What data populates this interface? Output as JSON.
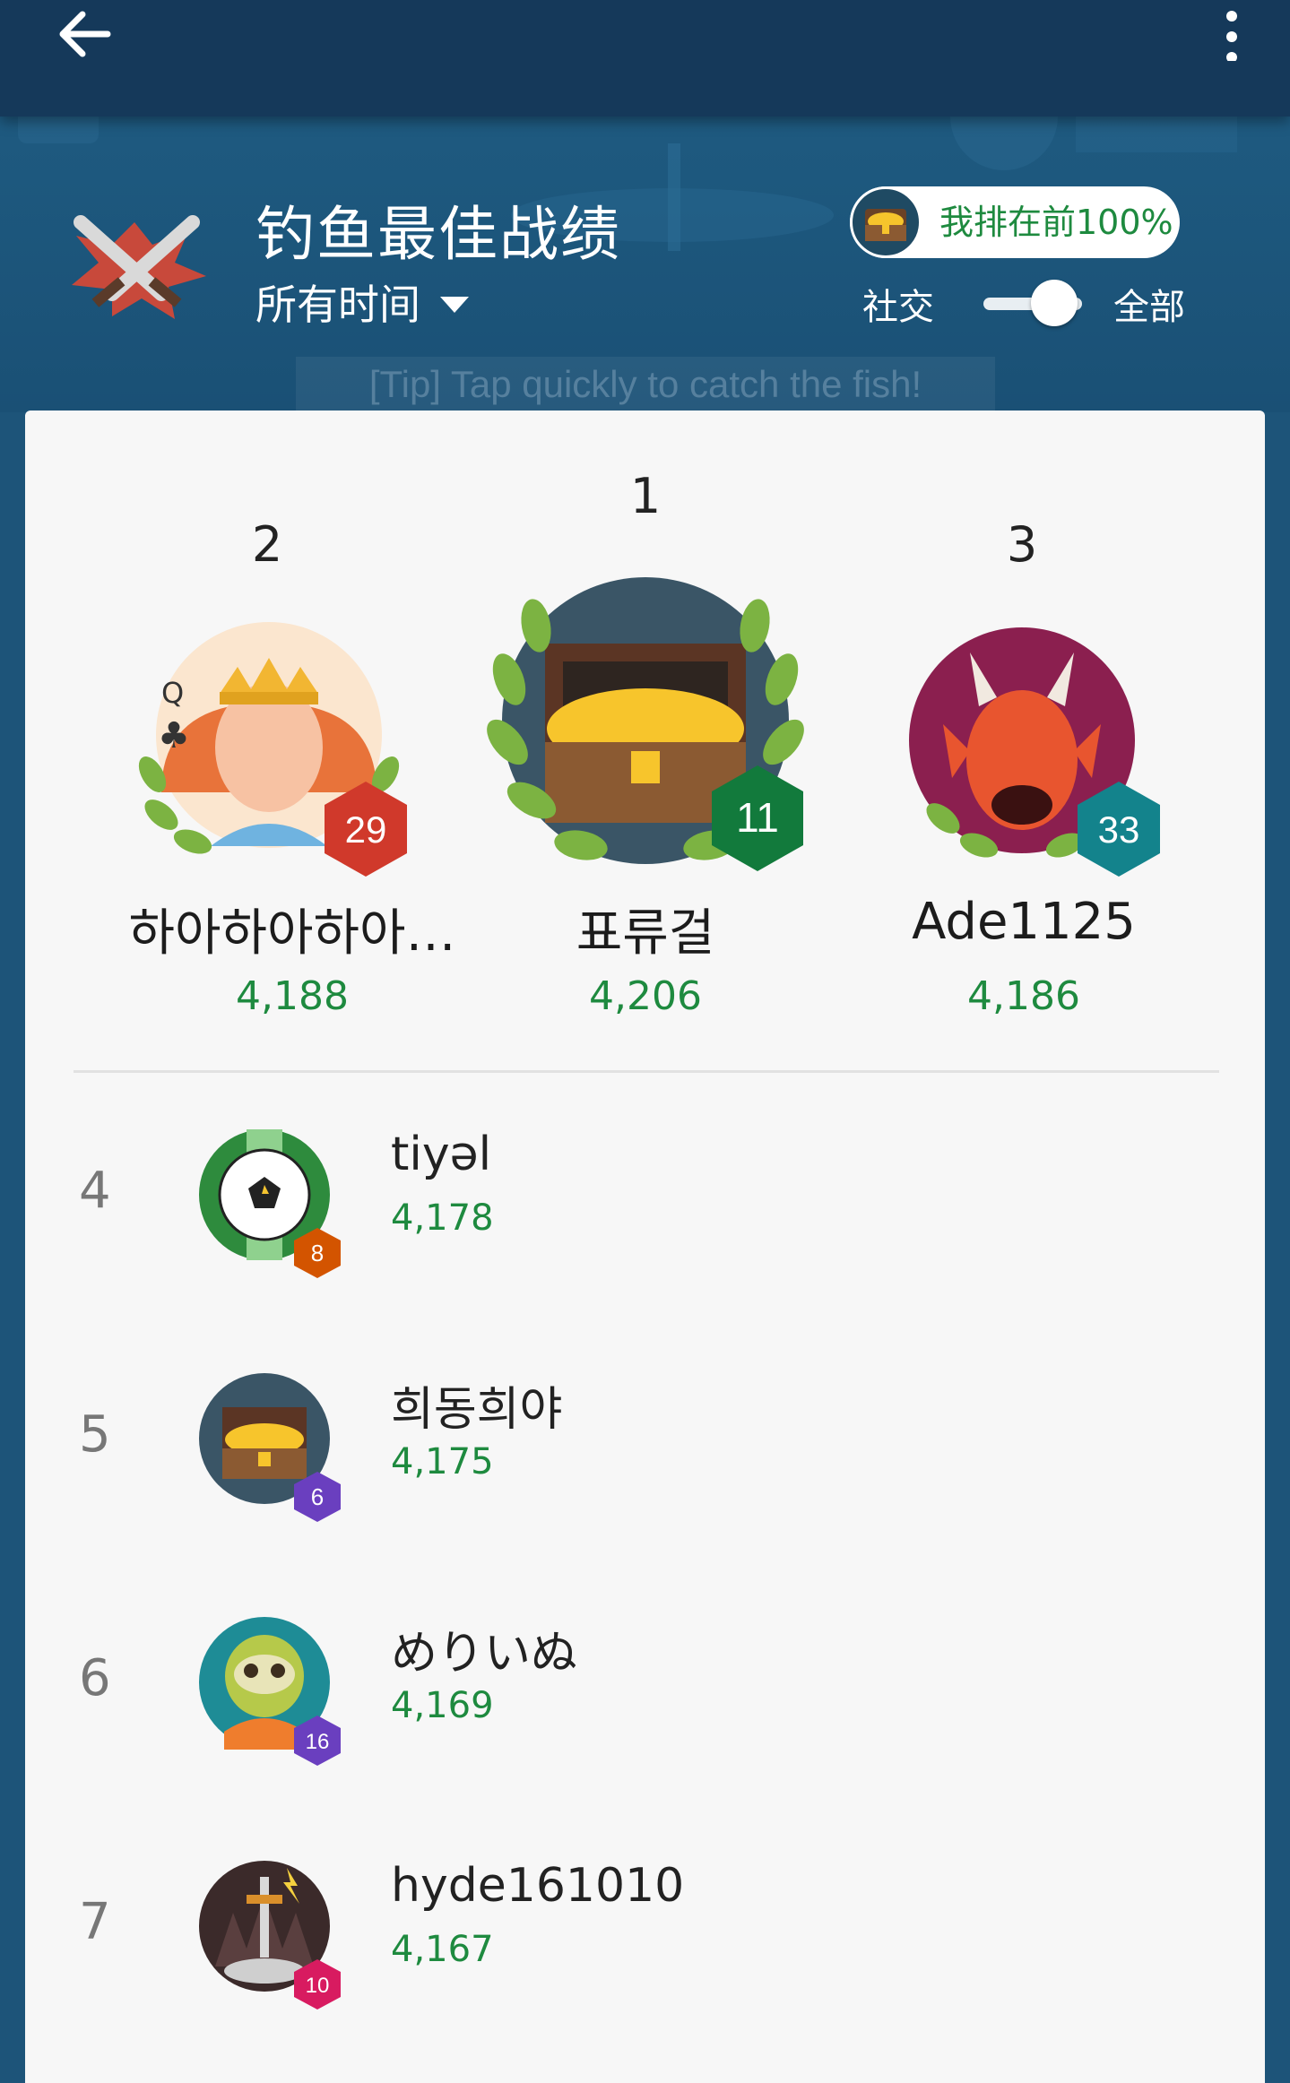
{
  "appbar": {
    "back_icon": "arrow-left-icon",
    "more_icon": "more-vertical-icon"
  },
  "background_tip": "[Tip] Tap quickly to catch the fish!",
  "header": {
    "title": "钓鱼最佳战绩",
    "time_filter": "所有时间",
    "rank_badge": "我排在前100%",
    "toggle_left": "社交",
    "toggle_right": "全部",
    "toggle_on": true
  },
  "podium": [
    {
      "rank": "2",
      "name": "하아하아하아…",
      "score": "4,188",
      "level": "29",
      "level_color": "#d0392b",
      "avatar": "queen-avatar"
    },
    {
      "rank": "1",
      "name": "표류걸",
      "score": "4,206",
      "level": "11",
      "level_color": "#127a3c",
      "avatar": "treasure-chest-avatar"
    },
    {
      "rank": "3",
      "name": "Ade1125",
      "score": "4,186",
      "level": "33",
      "level_color": "#13838c",
      "avatar": "dragon-avatar"
    }
  ],
  "list": [
    {
      "rank": "4",
      "name": "tiyəl",
      "score": "4,178",
      "level": "8",
      "level_color": "#d35400",
      "avatar": "soccer-ball-avatar"
    },
    {
      "rank": "5",
      "name": "희동희야",
      "score": "4,175",
      "level": "6",
      "level_color": "#6a3fbf",
      "avatar": "treasure-chest-avatar"
    },
    {
      "rank": "6",
      "name": "めりいぬ",
      "score": "4,169",
      "level": "16",
      "level_color": "#6a3fbf",
      "avatar": "sloth-avatar"
    },
    {
      "rank": "7",
      "name": "hyde161010",
      "score": "4,167",
      "level": "10",
      "level_color": "#d81b60",
      "avatar": "sword-avatar"
    }
  ],
  "colors": {
    "appbar": "#15395a",
    "background": "#1d5479",
    "score_green": "#1e8a3f",
    "card": "#f7f7f7"
  }
}
